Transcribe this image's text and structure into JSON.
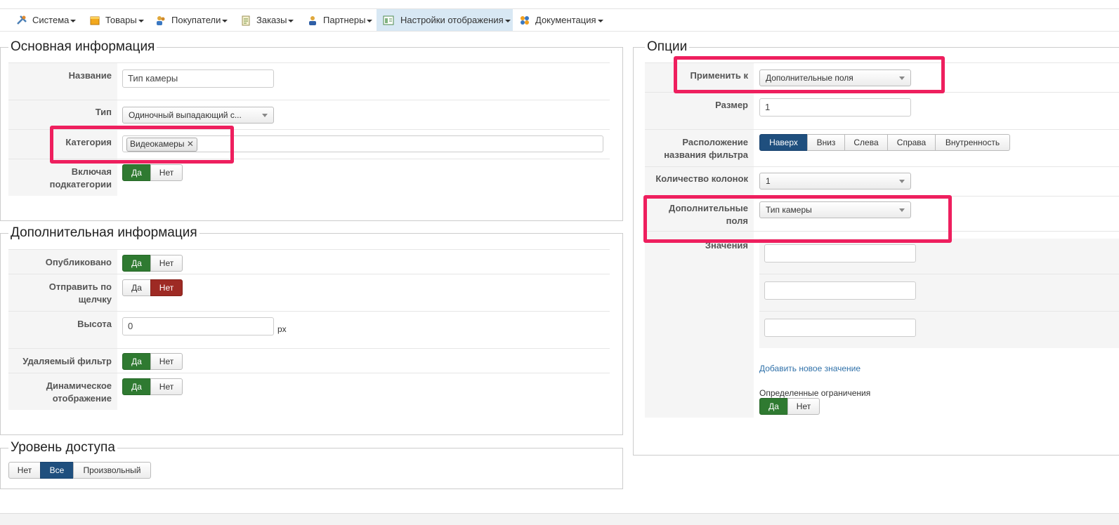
{
  "menu": {
    "items": [
      {
        "label": "Система",
        "icon": "tools-icon"
      },
      {
        "label": "Товары",
        "icon": "box-icon"
      },
      {
        "label": "Покупатели",
        "icon": "users-icon"
      },
      {
        "label": "Заказы",
        "icon": "orders-icon"
      },
      {
        "label": "Партнеры",
        "icon": "partners-icon"
      },
      {
        "label": "Настройки отображения",
        "icon": "display-icon"
      },
      {
        "label": "Документация",
        "icon": "docs-icon"
      }
    ]
  },
  "main_info": {
    "legend": "Основная информация",
    "name_label": "Название",
    "name_value": "Тип камеры",
    "type_label": "Тип",
    "type_value": "Одиночный выпадающий с...",
    "category_label": "Категория",
    "category_chip": "Видеокамеры",
    "include_sub_label_1": "Включая",
    "include_sub_label_2": "подкатегории",
    "yes": "Да",
    "no": "Нет"
  },
  "extra_info": {
    "legend": "Дополнительная информация",
    "published_label": "Опубликовано",
    "send_click_label_1": "Отправить по",
    "send_click_label_2": "щелчку",
    "height_label": "Высота",
    "height_value": "0",
    "height_unit": "px",
    "removable_label": "Удаляемый фильтр",
    "dynamic_label_1": "Динамическое",
    "dynamic_label_2": "отображение",
    "yes": "Да",
    "no": "Нет"
  },
  "access": {
    "legend": "Уровень доступа",
    "options": [
      "Нет",
      "Все",
      "Произвольный"
    ]
  },
  "options": {
    "legend": "Опции",
    "apply_label": "Применить к",
    "apply_value": "Дополнительные поля",
    "size_label": "Размер",
    "size_value": "1",
    "position_label_1": "Расположение",
    "position_label_2": "названия фильтра",
    "position_options": [
      "Наверх",
      "Вниз",
      "Слева",
      "Справа",
      "Внутренность"
    ],
    "columns_label": "Количество колонок",
    "columns_value": "1",
    "extra_fields_label_1": "Дополнительные",
    "extra_fields_label_2": "поля",
    "extra_fields_value": "Тип камеры",
    "values_label": "Значения",
    "add_value_link": "Добавить новое значение",
    "limits_label": "Определенные ограничения",
    "yes": "Да",
    "no": "Нет"
  },
  "colors": {
    "highlight": "#ee1f5e",
    "green": "#2f7a31",
    "red": "#9e2a24",
    "blue": "#1f4f7e"
  }
}
